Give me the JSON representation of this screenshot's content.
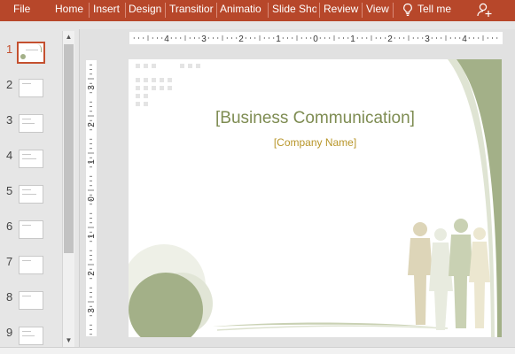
{
  "ribbon": {
    "tabs": [
      {
        "label": "File"
      },
      {
        "label": "Home"
      },
      {
        "label": "Insert"
      },
      {
        "label": "Design"
      },
      {
        "label": "Transitior"
      },
      {
        "label": "Animatio"
      },
      {
        "label": "Slide Sho"
      },
      {
        "label": "Review"
      },
      {
        "label": "View"
      }
    ],
    "tell_me": "Tell me",
    "icons": {
      "tell_me": "lightbulb-icon",
      "share": "add-user-icon"
    }
  },
  "thumbnails": {
    "selected": 1,
    "items": [
      {
        "number": "1"
      },
      {
        "number": "2"
      },
      {
        "number": "3"
      },
      {
        "number": "4"
      },
      {
        "number": "5"
      },
      {
        "number": "6"
      },
      {
        "number": "7"
      },
      {
        "number": "8"
      },
      {
        "number": "9"
      }
    ]
  },
  "rulers": {
    "horizontal": [
      "4",
      "3",
      "2",
      "1",
      "0",
      "1",
      "2",
      "3",
      "4"
    ],
    "vertical": [
      "3",
      "2",
      "1",
      "0",
      "1",
      "2",
      "3"
    ]
  },
  "slide": {
    "title": "[Business Communication]",
    "subtitle": "[Company Name]"
  },
  "colors": {
    "ribbon": "#b7472a",
    "title": "#7e8c52",
    "subtitle": "#b8962a",
    "accent_green": "#a3b088",
    "light_green": "#dfe4d3",
    "silhouette": "#ddd5b8"
  }
}
